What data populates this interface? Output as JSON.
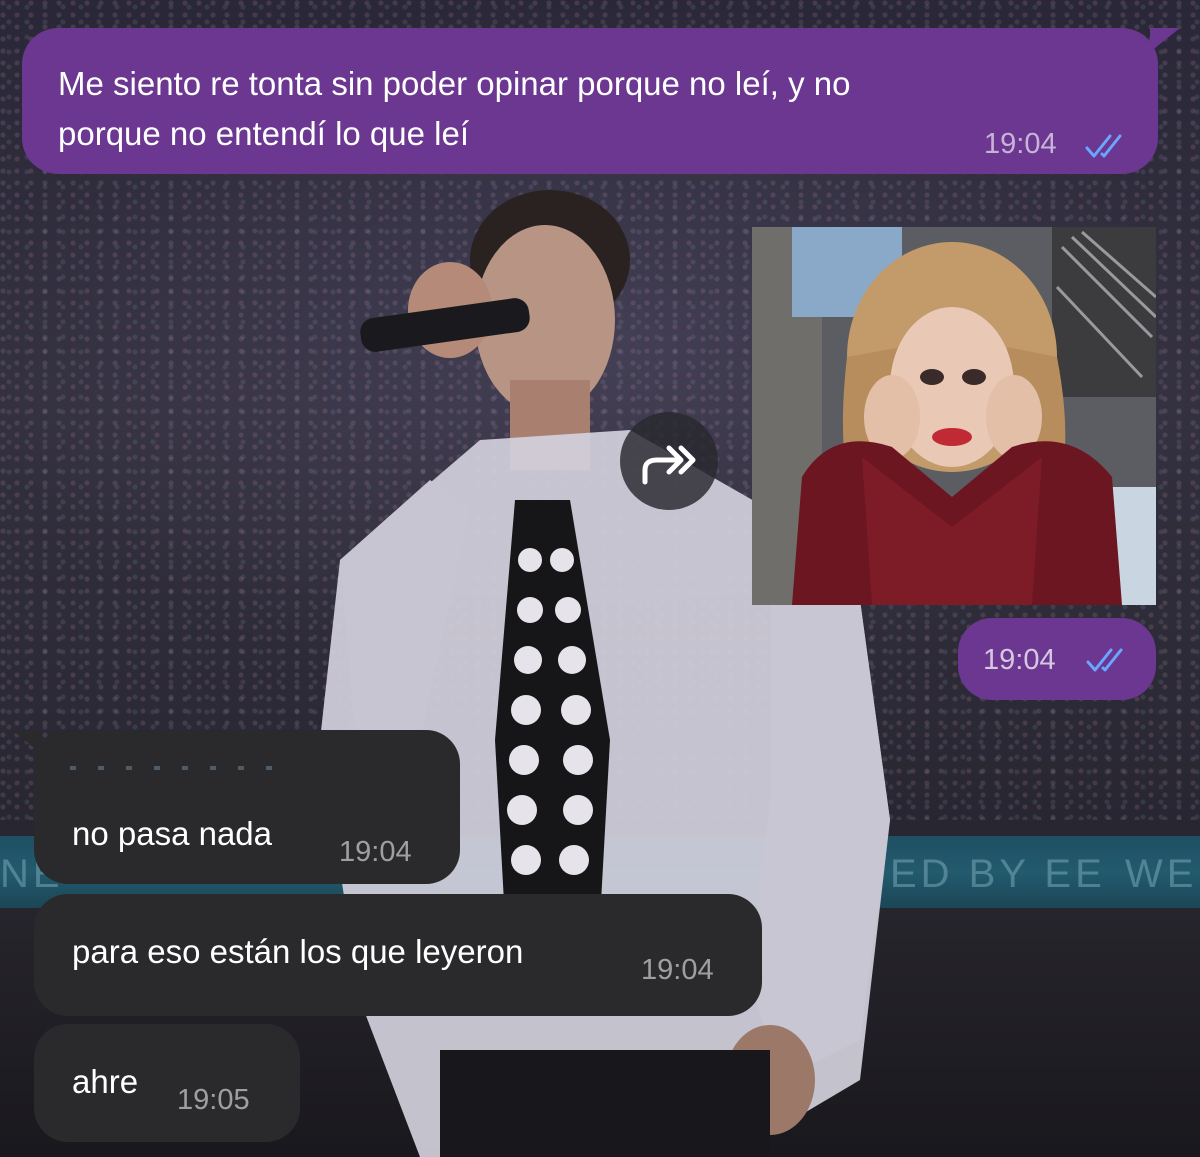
{
  "chat": {
    "messages": [
      {
        "direction": "outgoing",
        "type": "text",
        "text": "Me siento re tonta sin poder opinar porque no leí, y no porque no entendí lo que leí",
        "line1": "Me siento re tonta sin poder opinar porque no leí, y no",
        "line2": "porque no entendí lo que leí",
        "time": "19:04",
        "status": "read"
      },
      {
        "direction": "outgoing",
        "type": "image",
        "image_icon": "crying-woman-meme-photo",
        "time": "19:04",
        "status": "read"
      },
      {
        "direction": "incoming",
        "type": "text",
        "text": "no pasa nada",
        "time": "19:04"
      },
      {
        "direction": "incoming",
        "type": "text",
        "text": "para eso están los que leyeron",
        "time": "19:04"
      },
      {
        "direction": "incoming",
        "type": "text",
        "text": "ahre",
        "time": "19:05"
      }
    ],
    "forward_button_icon": "forward-arrow-icon",
    "read_status_icon": "double-check-icon"
  },
  "wallpaper": {
    "banner_left": "NE",
    "banner_right": "ED BY EE",
    "banner_far_right": "WE"
  },
  "colors": {
    "outgoing_bubble": "#6b3791",
    "incoming_bubble": "#2a2a2c",
    "read_ticks": "#6aa6ff"
  }
}
